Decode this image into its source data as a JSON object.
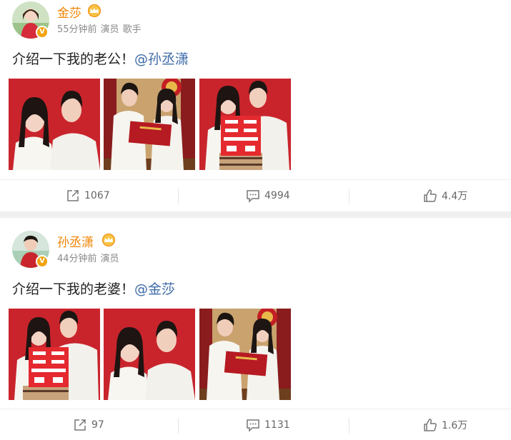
{
  "posts": [
    {
      "username": "金莎",
      "time": "55分钟前",
      "tags": [
        "演员",
        "歌手"
      ],
      "text": "介绍一下我的老公！",
      "mention": "@孙丞潇",
      "actions": {
        "repost": "1067",
        "comment": "4994",
        "like": "4.4万"
      }
    },
    {
      "username": "孙丞潇",
      "time": "44分钟前",
      "tags": [
        "演员"
      ],
      "text": "介绍一下我的老婆！",
      "mention": "@金莎",
      "actions": {
        "repost": "97",
        "comment": "1131",
        "like": "1.6万"
      }
    }
  ],
  "icons": {
    "verified": "V",
    "repost": "repost-icon",
    "comment": "comment-icon",
    "like": "thumbs-up-icon",
    "crown": "crown-icon"
  },
  "colors": {
    "username": "#f08300",
    "mention": "#3d6aa8",
    "meta": "#8a8a8a",
    "photo_red": "#c9242c",
    "verified_badge": "#f2a30f"
  }
}
